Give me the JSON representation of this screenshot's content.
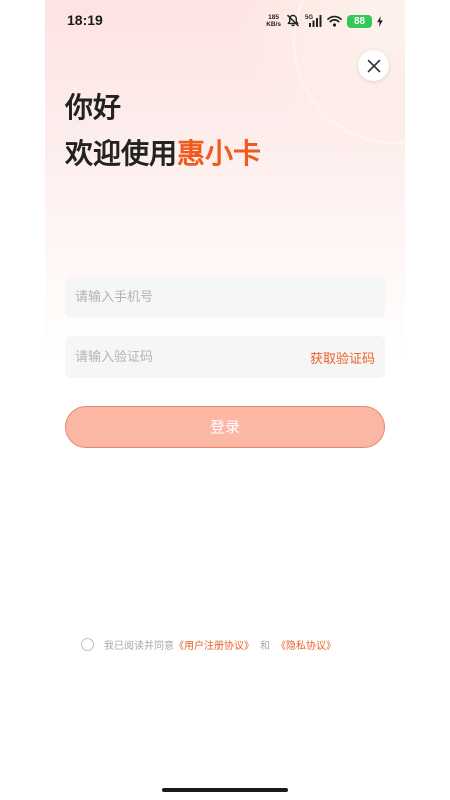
{
  "status_bar": {
    "time": "18:19",
    "net_speed_value": "185",
    "net_speed_unit": "KB/s",
    "network_type": "5G",
    "battery_level": "88",
    "icons": [
      "mute-icon",
      "signal-icon",
      "wifi-icon",
      "battery-icon",
      "charging-icon"
    ]
  },
  "header": {
    "close_icon": "close-icon",
    "greeting": "你好",
    "welcome_prefix": "欢迎使用",
    "brand_name": "惠小卡"
  },
  "form": {
    "phone_placeholder": "请输入手机号",
    "phone_value": "",
    "code_placeholder": "请输入验证码",
    "code_value": "",
    "get_code_label": "获取验证码",
    "login_label": "登录"
  },
  "agreement": {
    "checked": false,
    "prefix": "我已阅读并同意",
    "user_agreement": "《用户注册协议》",
    "conjunction": "和",
    "privacy_policy": "《隐私协议》"
  },
  "colors": {
    "accent": "#f05a1e",
    "link": "#e8622a",
    "login_button": "#fbb7a4",
    "battery": "#35c759",
    "text_primary": "#222222",
    "placeholder": "#b3b3b3"
  }
}
